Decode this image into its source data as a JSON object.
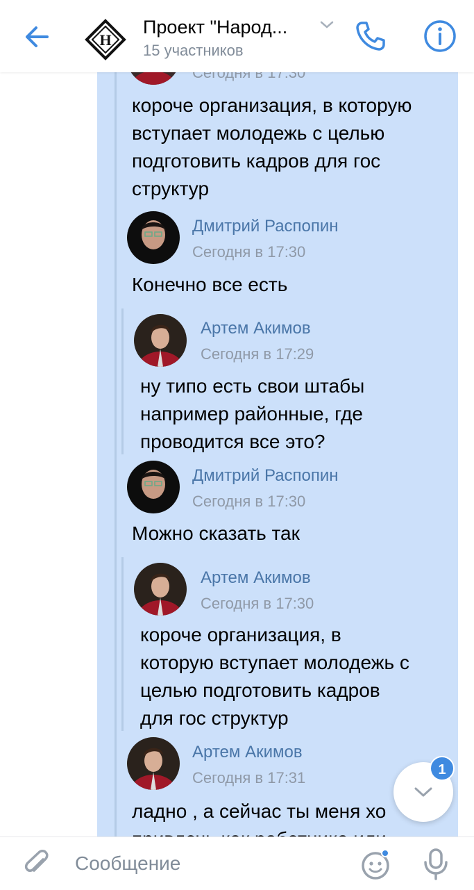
{
  "header": {
    "title": "Проект \"Народ...",
    "subtitle": "15 участников"
  },
  "messages": {
    "m0": {
      "time_partial": "Сегодня в 17:30",
      "lines": [
        "короче организация, в которую",
        "вступает молодежь с целью",
        "подготовить кадров для гос",
        "структур"
      ]
    },
    "m1": {
      "author": "Дмитрий Распопин",
      "time": "Сегодня в 17:30",
      "lines": [
        "Конечно все есть"
      ]
    },
    "m1_reply": {
      "author": "Артем Акимов",
      "time": "Сегодня в 17:29",
      "lines": [
        "ну типо есть свои штабы",
        "например районные, где",
        "проводится все это?"
      ]
    },
    "m2": {
      "author": "Дмитрий Распопин",
      "time": "Сегодня в 17:30",
      "lines": [
        "Можно сказать так"
      ]
    },
    "m2_reply": {
      "author": "Артем Акимов",
      "time": "Сегодня в 17:30",
      "lines": [
        "короче организация, в",
        "которую вступает молодежь с",
        "целью подготовить кадров",
        "для гос структур"
      ]
    },
    "m3": {
      "author": "Артем Акимов",
      "time": "Сегодня в 17:31",
      "lines": [
        "ладно , а сейчас ты меня хо",
        "привлечь как работника или"
      ]
    }
  },
  "scroll_down": {
    "badge": "1"
  },
  "composer": {
    "placeholder": "Сообщение"
  },
  "colors": {
    "accent": "#3f8ae0",
    "selection": "#cce0fa",
    "author": "#4a76a8",
    "secondary": "#818c99"
  },
  "icons": {
    "back": "arrow-left-icon",
    "logo": "chat-logo-icon",
    "chevron": "chevron-down-icon",
    "call": "phone-icon",
    "info": "info-icon",
    "attach": "paperclip-icon",
    "sticker": "smile-icon",
    "mic": "microphone-icon",
    "scroll": "chevron-down-icon"
  }
}
